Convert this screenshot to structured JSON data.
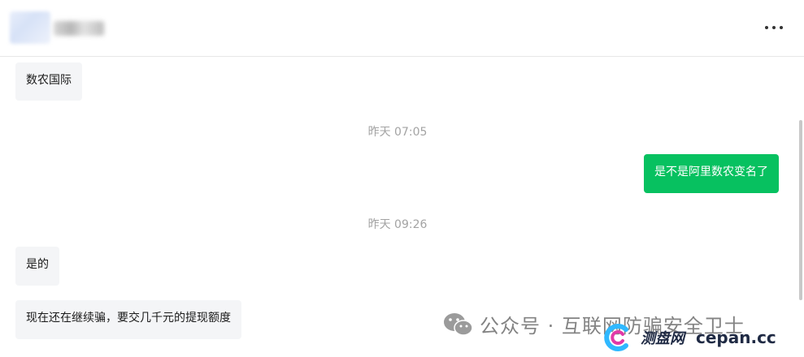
{
  "header": {
    "contact_name": "",
    "more_label": "更多"
  },
  "messages": [
    {
      "side": "left",
      "text": "数农国际"
    },
    {
      "timestamp": "昨天 07:05"
    },
    {
      "side": "right",
      "text": "是不是阿里数农变名了"
    },
    {
      "timestamp": "昨天 09:26"
    },
    {
      "side": "left",
      "text": "是的"
    },
    {
      "side": "left",
      "text": "现在还在继续骗，要交几千元的提现额度"
    }
  ],
  "watermark": {
    "account_text": "公众号 · 互联网防骗安全卫士",
    "site_cn": "测盘网",
    "site_en": "cepan.cc"
  },
  "colors": {
    "outgoing_bubble": "#07c160",
    "incoming_bubble": "#f4f5f7",
    "timestamp": "#a3a3a3"
  }
}
